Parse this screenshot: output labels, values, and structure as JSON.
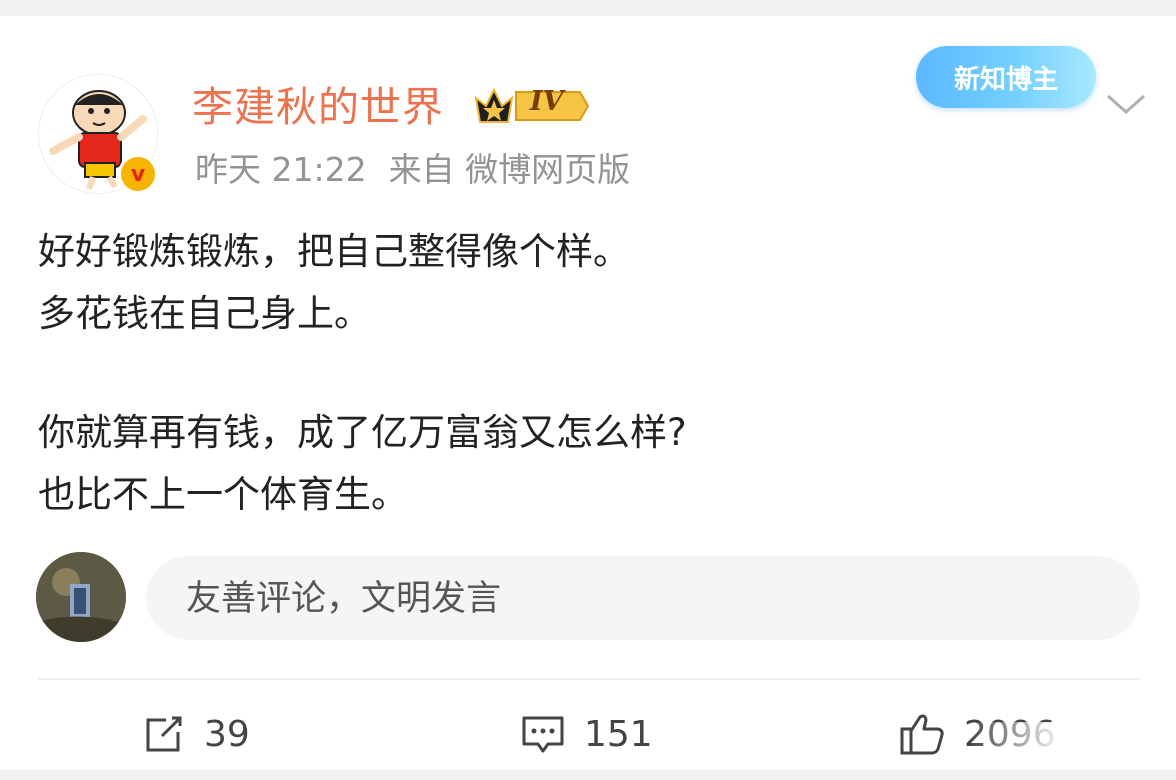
{
  "post": {
    "author_name": "李建秋的世界",
    "level_badge": "IV",
    "time": "昨天 21:22",
    "source": "来自 微博网页版",
    "blogger_badge": "新知博主",
    "verified_mark": "v",
    "paragraphs": [
      "好好锻炼锻炼，把自己整得像个样。",
      "多花钱在自己身上。",
      "",
      "你就算再有钱，成了亿万富翁又怎么样?",
      "也比不上一个体育生。"
    ]
  },
  "comment": {
    "placeholder": "友善评论，文明发言"
  },
  "actions": {
    "repost_count": "39",
    "comment_count": "151",
    "like_count": "2096"
  },
  "colors": {
    "name": "#eb7350",
    "meta": "#939393",
    "badge_blue": "#5bb8ff",
    "verify_gold": "#f6b400"
  },
  "icons": [
    "crown-icon",
    "chevron-down-icon",
    "repost-icon",
    "comment-icon",
    "like-icon",
    "verified-icon"
  ]
}
